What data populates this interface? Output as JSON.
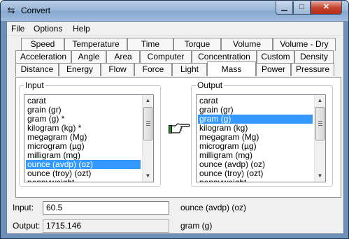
{
  "window": {
    "title": "Convert",
    "app_icon": "convert-arrows-icon"
  },
  "menu": {
    "items": [
      "File",
      "Options",
      "Help"
    ]
  },
  "tabs": {
    "row1": [
      "Speed",
      "Temperature",
      "Time",
      "Torque",
      "Volume",
      "Volume - Dry"
    ],
    "row2": [
      "Acceleration",
      "Angle",
      "Area",
      "Computer",
      "Concentration",
      "Custom",
      "Density"
    ],
    "row3": [
      "Distance",
      "Energy",
      "Flow",
      "Force",
      "Light",
      "Mass",
      "Power",
      "Pressure"
    ],
    "active": "Mass"
  },
  "input_group": {
    "legend": "Input",
    "items": [
      "carat",
      "grain (gr)",
      "gram (g) *",
      "kilogram (kg) *",
      "megagram (Mg)",
      "microgram (µg)",
      "milligram (mg)",
      "ounce (avdp) (oz)",
      "ounce (troy) (ozt)",
      "pennyweight"
    ],
    "selected": "ounce (avdp) (oz)"
  },
  "output_group": {
    "legend": "Output",
    "items": [
      "carat",
      "grain (gr)",
      "gram (g)",
      "kilogram (kg)",
      "megagram (Mg)",
      "microgram (µg)",
      "milligram (mg)",
      "ounce (avdp) (oz)",
      "ounce (troy) (ozt)",
      "pennyweight"
    ],
    "selected": "gram (g)"
  },
  "direction_icon": "pointing-hand-icon",
  "input_field": {
    "label": "Input:",
    "value": "60.5",
    "unit": "ounce (avdp) (oz)"
  },
  "output_field": {
    "label": "Output:",
    "value": "1715.146",
    "unit": "gram (g)"
  }
}
